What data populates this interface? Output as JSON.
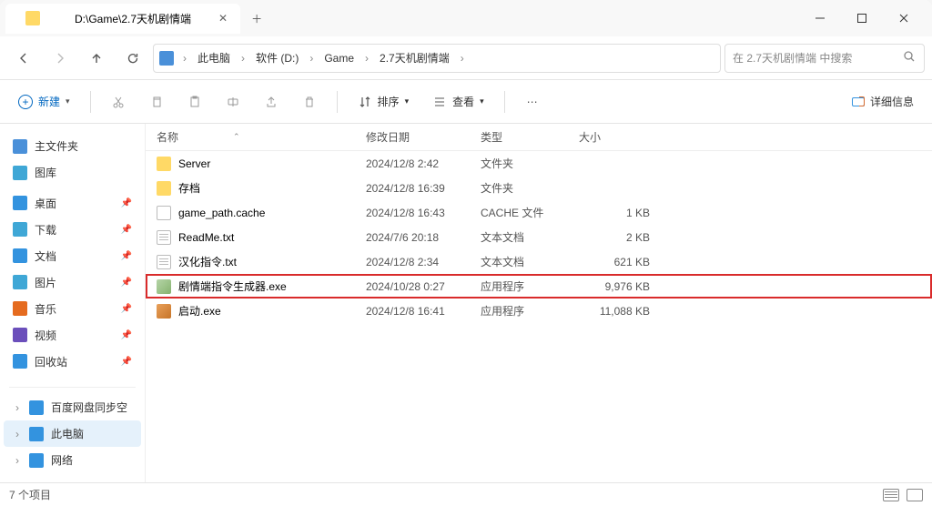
{
  "window": {
    "title": "D:\\Game\\2.7天机剧情端"
  },
  "tab": {
    "title": "D:\\Game\\2.7天机剧情端"
  },
  "breadcrumb": [
    "此电脑",
    "软件 (D:)",
    "Game",
    "2.7天机剧情端"
  ],
  "search": {
    "placeholder": "在 2.7天机剧情端 中搜索"
  },
  "toolbar": {
    "new_label": "新建",
    "sort_label": "排序",
    "view_label": "查看",
    "details_label": "详细信息"
  },
  "sidebar": {
    "home": "主文件夹",
    "gallery": "图库",
    "desktop": "桌面",
    "downloads": "下载",
    "documents": "文档",
    "pictures": "图片",
    "music": "音乐",
    "videos": "视频",
    "trash": "回收站",
    "baidu": "百度网盘同步空",
    "thispc": "此电脑",
    "network": "网络"
  },
  "columns": {
    "name": "名称",
    "date": "修改日期",
    "type": "类型",
    "size": "大小"
  },
  "files": [
    {
      "name": "Server",
      "date": "2024/12/8 2:42",
      "type": "文件夹",
      "size": "",
      "icon": "folder"
    },
    {
      "name": "存档",
      "date": "2024/12/8 16:39",
      "type": "文件夹",
      "size": "",
      "icon": "folder"
    },
    {
      "name": "game_path.cache",
      "date": "2024/12/8 16:43",
      "type": "CACHE 文件",
      "size": "1 KB",
      "icon": "cache"
    },
    {
      "name": "ReadMe.txt",
      "date": "2024/7/6 20:18",
      "type": "文本文档",
      "size": "2 KB",
      "icon": "txt"
    },
    {
      "name": "汉化指令.txt",
      "date": "2024/12/8 2:34",
      "type": "文本文档",
      "size": "621 KB",
      "icon": "txt"
    },
    {
      "name": "剧情端指令生成器.exe",
      "date": "2024/10/28 0:27",
      "type": "应用程序",
      "size": "9,976 KB",
      "icon": "exe1",
      "highlight": true
    },
    {
      "name": "启动.exe",
      "date": "2024/12/8 16:41",
      "type": "应用程序",
      "size": "11,088 KB",
      "icon": "exe2"
    }
  ],
  "status": {
    "count": "7 个项目"
  }
}
